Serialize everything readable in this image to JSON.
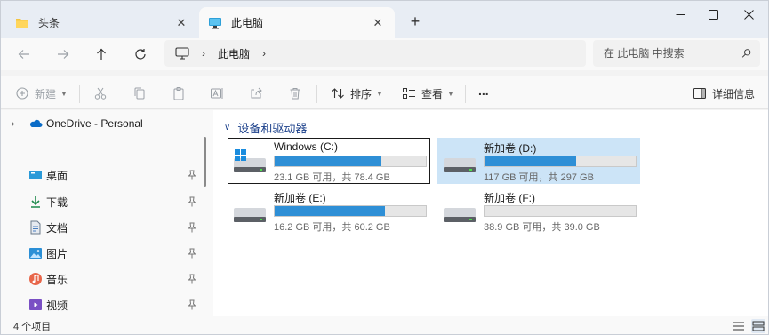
{
  "tabs": [
    {
      "label": "头条",
      "icon": "folder-icon",
      "active": false
    },
    {
      "label": "此电脑",
      "icon": "monitor-icon",
      "active": true
    }
  ],
  "breadcrumb": [
    "此电脑"
  ],
  "search": {
    "placeholder": "在 此电脑 中搜索"
  },
  "toolbar": {
    "new_label": "新建",
    "sort_label": "排序",
    "view_label": "查看",
    "more_label": "...",
    "details_label": "详细信息"
  },
  "sidebar": {
    "onedrive": "OneDrive - Personal",
    "items": [
      {
        "label": "桌面",
        "icon": "desktop-icon"
      },
      {
        "label": "下载",
        "icon": "download-icon"
      },
      {
        "label": "文档",
        "icon": "document-icon"
      },
      {
        "label": "图片",
        "icon": "picture-icon"
      },
      {
        "label": "音乐",
        "icon": "music-icon"
      },
      {
        "label": "视频",
        "icon": "video-icon"
      }
    ]
  },
  "section_title": "设备和驱动器",
  "drives": [
    {
      "name": "Windows (C:)",
      "size_text": "23.1 GB 可用，共 78.4 GB",
      "used_fraction": 0.705,
      "windows": true
    },
    {
      "name": "新加卷 (D:)",
      "size_text": "117 GB 可用，共 297 GB",
      "used_fraction": 0.606,
      "windows": false
    },
    {
      "name": "新加卷 (E:)",
      "size_text": "16.2 GB 可用，共 60.2 GB",
      "used_fraction": 0.731,
      "windows": false
    },
    {
      "name": "新加卷 (F:)",
      "size_text": "38.9 GB 可用，共 39.0 GB",
      "used_fraction": 0.003,
      "windows": false
    }
  ],
  "status": {
    "item_count": "4 个项目"
  },
  "colors": {
    "accent": "#2e8fd6",
    "selection": "#cce4f7",
    "section_header": "#1a3f8a"
  }
}
